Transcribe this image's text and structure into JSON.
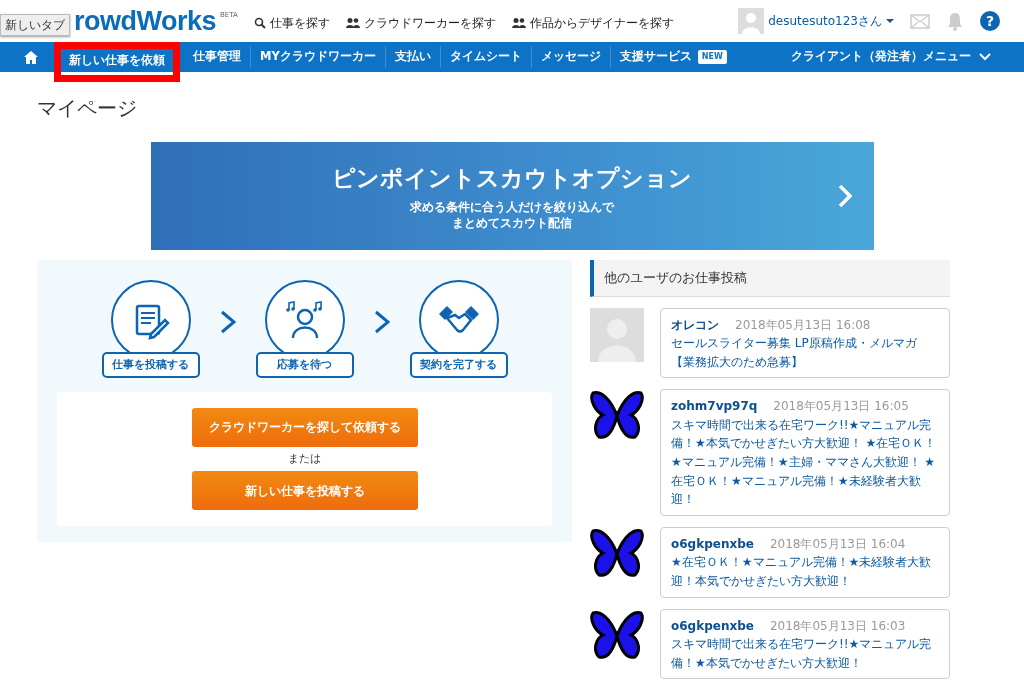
{
  "header": {
    "logo": "rowdWorks",
    "logo_badge": "BETA",
    "tooltip": "新しいタブ",
    "links": [
      {
        "kind": "search",
        "label": "仕事を探す"
      },
      {
        "kind": "people",
        "label": "クラウドワーカーを探す"
      },
      {
        "kind": "people",
        "label": "作品からデザイナーを探す"
      }
    ],
    "user": "desutesuto123さん",
    "help": "?"
  },
  "nav": {
    "items": [
      {
        "label": "新しい仕事を依頼",
        "selected": true,
        "highlighted": true
      },
      {
        "label": "仕事管理",
        "selected": false,
        "highlighted": false
      },
      {
        "label": "MYクラウドワーカー",
        "selected": false,
        "highlighted": false
      },
      {
        "label": "支払い",
        "selected": false,
        "highlighted": false
      },
      {
        "label": "タイムシート",
        "selected": false,
        "highlighted": false
      },
      {
        "label": "メッセージ",
        "selected": false,
        "highlighted": false
      },
      {
        "label": "支援サービス",
        "selected": false,
        "highlighted": false,
        "badge": "NEW"
      }
    ],
    "menu": "クライアント（発注者）メニュー"
  },
  "page_title": "マイページ",
  "banner": {
    "title": "ピンポイントスカウトオプション",
    "subtitle_lines": [
      "求める条件に合う人だけを絞り込んで",
      "まとめてスカウト配信"
    ]
  },
  "steps": [
    {
      "kind": "post",
      "label": "仕事を投稿する"
    },
    {
      "kind": "wait",
      "label": "応募を待つ"
    },
    {
      "kind": "deal",
      "label": "契約を完了する"
    }
  ],
  "actions": {
    "primary": "クラウドワーカーを探して依頼する",
    "separator": "または",
    "secondary": "新しい仕事を投稿する"
  },
  "posts_panel": {
    "title": "他のユーザのお仕事投稿",
    "posts": [
      {
        "kind": "default",
        "user": "オレコン",
        "date": "2018年05月13日 16:08",
        "text": "セールスライター募集 LP原稿作成・メルマガ【業務拡大のため急募】"
      },
      {
        "kind": "butterfly",
        "user": "zohm7vp97q",
        "date": "2018年05月13日 16:05",
        "text": "スキマ時間で出来る在宅ワーク!!★マニュアル完備！★本気でかせぎたい方大歓迎！ ★在宅ＯＫ！★マニュアル完備！★主婦・ママさん大歓迎！ ★在宅ＯＫ！★マニュアル完備！★未経験者大歓迎！"
      },
      {
        "kind": "butterfly",
        "user": "o6gkpenxbe",
        "date": "2018年05月13日 16:04",
        "text": "★在宅ＯＫ！★マニュアル完備！★未経験者大歓迎！本気でかせぎたい方大歓迎！"
      },
      {
        "kind": "butterfly",
        "user": "o6gkpenxbe",
        "date": "2018年05月13日 16:03",
        "text": "スキマ時間で出来る在宅ワーク!!★マニュアル完備！★本気でかせぎたい方大歓迎！"
      }
    ]
  }
}
